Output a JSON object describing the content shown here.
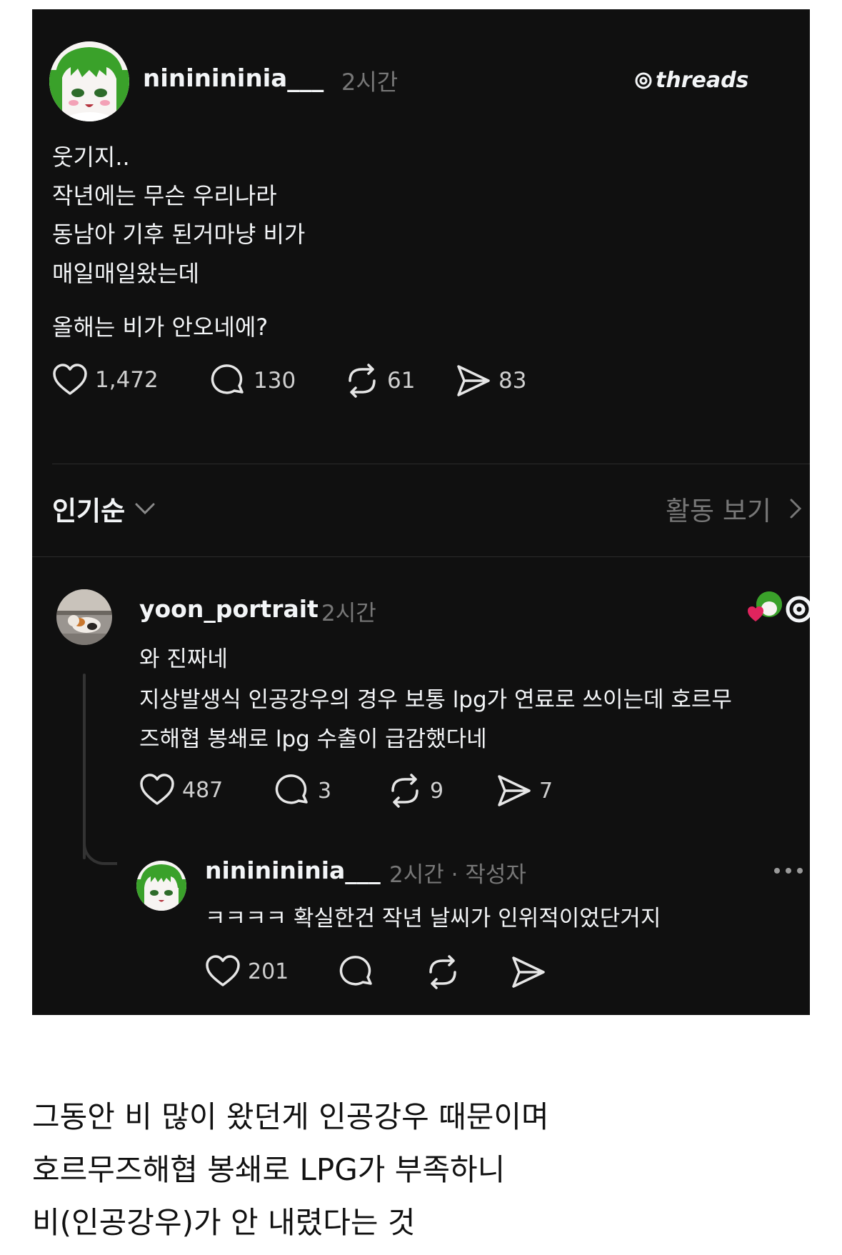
{
  "post": {
    "username": "nininininia___",
    "time": "2시간",
    "brand": "threads",
    "lines": [
      "웃기지..",
      "작년에는 무슨 우리나라",
      "동남아 기후 된거마냥 비가",
      "매일매일왔는데"
    ],
    "line_after_gap": "올해는 비가 안오네에?",
    "likes": "1,472",
    "replies": "130",
    "reposts": "61",
    "shares": "83"
  },
  "sort": {
    "label": "인기순",
    "activity_link": "활동 보기"
  },
  "reply1": {
    "username": "yoon_portrait",
    "time": "2시간",
    "lines": [
      "와 진짜네",
      "지상발생식 인공강우의 경우 보통 lpg가 연료로 쓰이는데 호르무",
      "즈해협 봉쇄로 lpg 수출이 급감했다네"
    ],
    "likes": "487",
    "replies": "3",
    "reposts": "9",
    "shares": "7"
  },
  "reply2": {
    "username": "nininininia___",
    "meta": "2시간 · 작성자",
    "text": "ㅋㅋㅋㅋ 확실한건 작년 날씨가 인위적이었단거지",
    "likes": "201"
  },
  "caption": [
    "그동안 비 많이 왔던게 인공강우 때문이며",
    "호르무즈해협 봉쇄로 LPG가 부족하니",
    "비(인공강우)가 안 내렸다는 것"
  ],
  "colors": {
    "background": "#101010",
    "text": "#f3f5f7",
    "muted": "#777777",
    "avatar_hair": "#3aa12a",
    "like_heart": "#e0245e"
  },
  "icons": [
    "heart-icon",
    "comment-icon",
    "repost-icon",
    "share-icon",
    "chevron-down-icon",
    "chevron-right-icon",
    "threads-logo-icon",
    "more-icon"
  ]
}
